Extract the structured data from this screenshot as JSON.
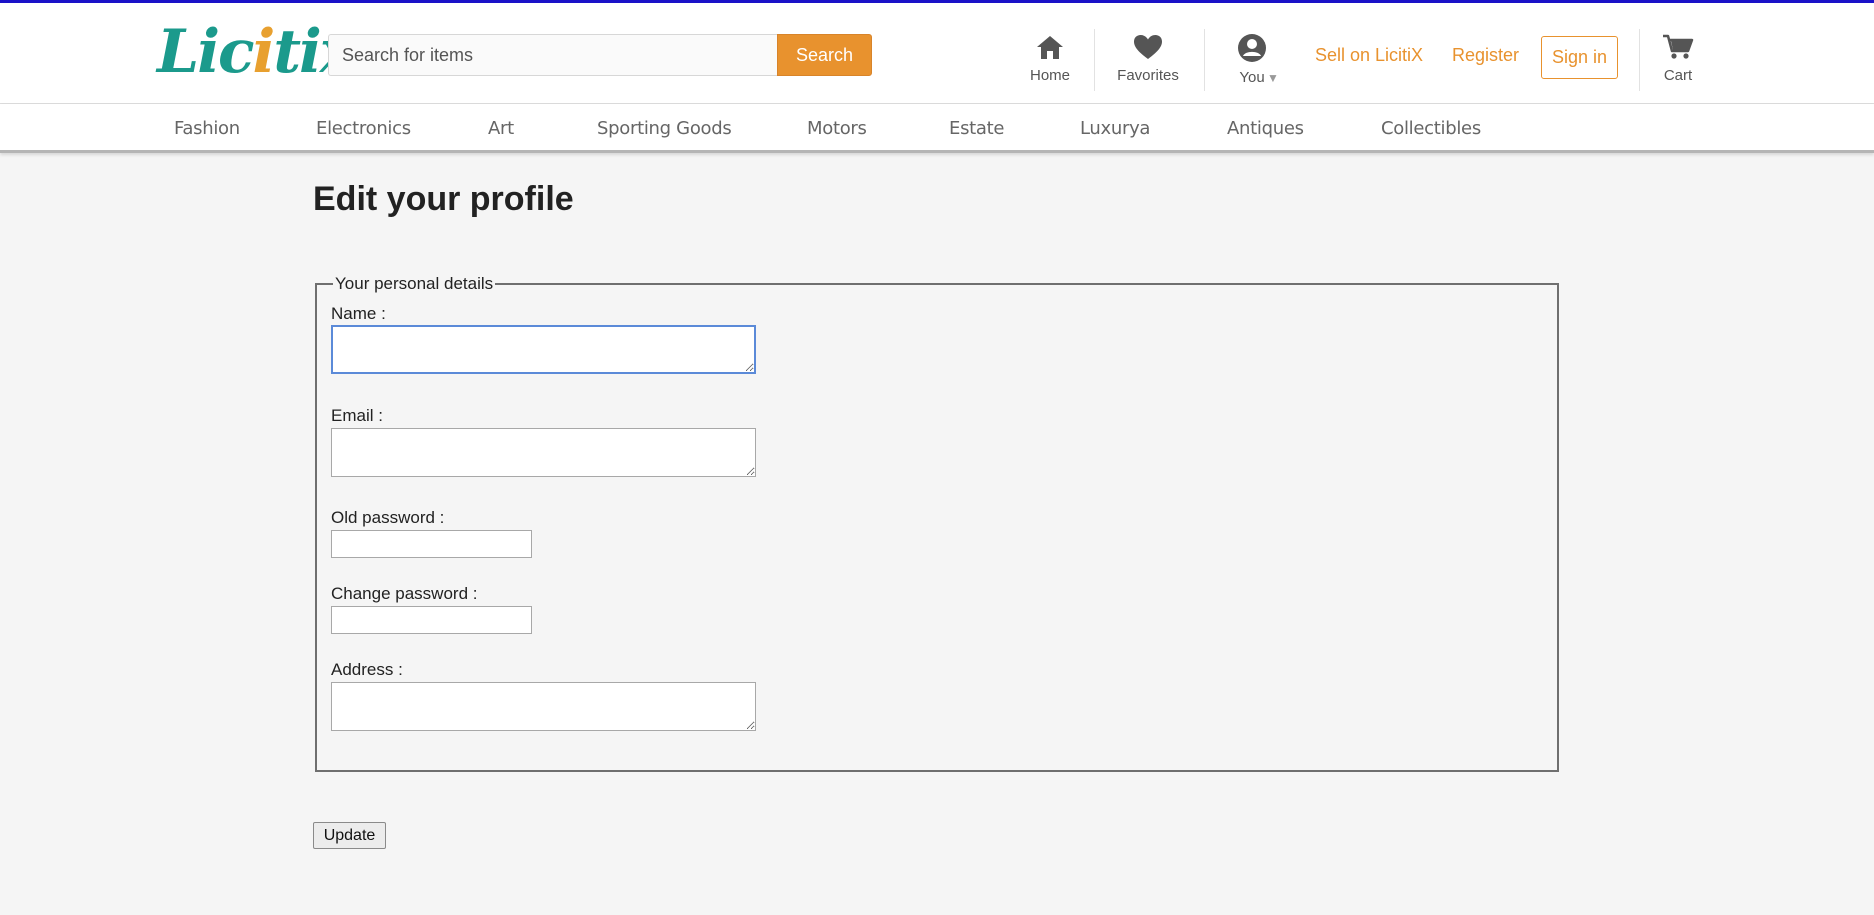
{
  "header": {
    "logo_text": "Licitix",
    "search": {
      "placeholder": "Search for items",
      "value": "",
      "button_label": "Search"
    },
    "nav": {
      "home_label": "Home",
      "favorites_label": "Favorites",
      "you_label": "You",
      "sell_label": "Sell on LicitiX",
      "register_label": "Register",
      "signin_label": "Sign in",
      "cart_label": "Cart"
    },
    "icons": {
      "home": "home-icon",
      "favorites": "heart-icon",
      "you": "user-icon",
      "you_caret": "caret-down-icon",
      "cart": "cart-icon"
    }
  },
  "categories": [
    "Fashion",
    "Electronics",
    "Art",
    "Sporting Goods",
    "Motors",
    "Estate",
    "Luxurya",
    "Antiques",
    "Collectibles"
  ],
  "page": {
    "title": "Edit your profile",
    "fieldset_legend": "Your personal details",
    "fields": {
      "name_label": "Name :",
      "name_value": "",
      "email_label": "Email :",
      "email_value": "",
      "old_password_label": "Old password :",
      "change_password_label": "Change password :",
      "address_label": "Address :",
      "address_value": ""
    },
    "update_label": "Update"
  },
  "colors": {
    "brand_teal": "#1b9a8c",
    "accent_orange": "#e8922e",
    "top_line": "#1a12c8",
    "background": "#f5f5f5"
  }
}
